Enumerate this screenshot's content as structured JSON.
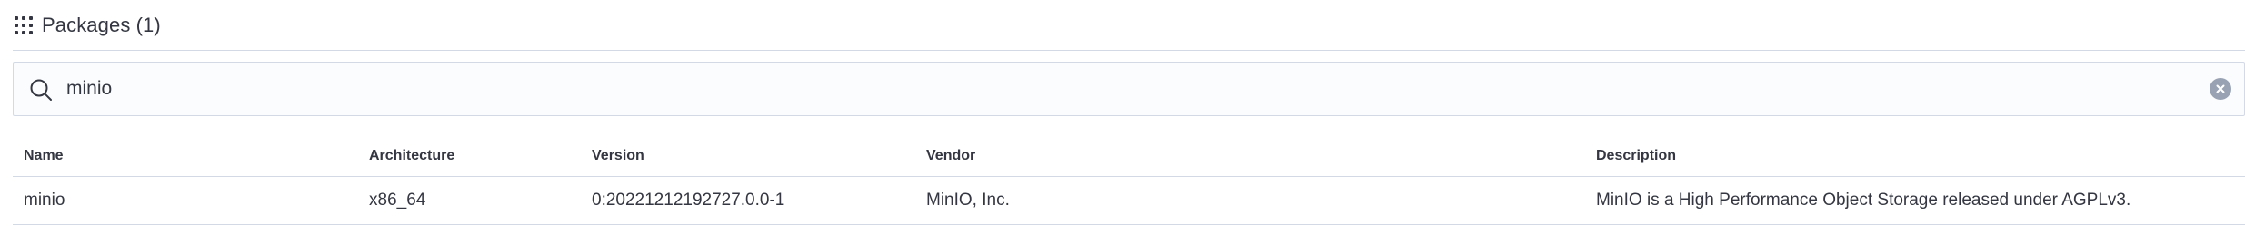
{
  "panel": {
    "title": "Packages (1)",
    "icon": "apps-grid-icon"
  },
  "search": {
    "value": "minio",
    "placeholder": "Search",
    "icon": "search-icon",
    "clear_icon": "clear-icon"
  },
  "table": {
    "columns": [
      "Name",
      "Architecture",
      "Version",
      "Vendor",
      "Description"
    ],
    "rows": [
      {
        "name": "minio",
        "architecture": "x86_64",
        "version": "0:20221212192727.0.0-1",
        "vendor": "MinIO, Inc.",
        "description": "MinIO is a High Performance Object Storage released under AGPLv3."
      }
    ]
  },
  "colors": {
    "text": "#343741",
    "border": "#d3dae6",
    "input_bg": "#fbfcfd",
    "clear_button": "#98a2b3"
  }
}
